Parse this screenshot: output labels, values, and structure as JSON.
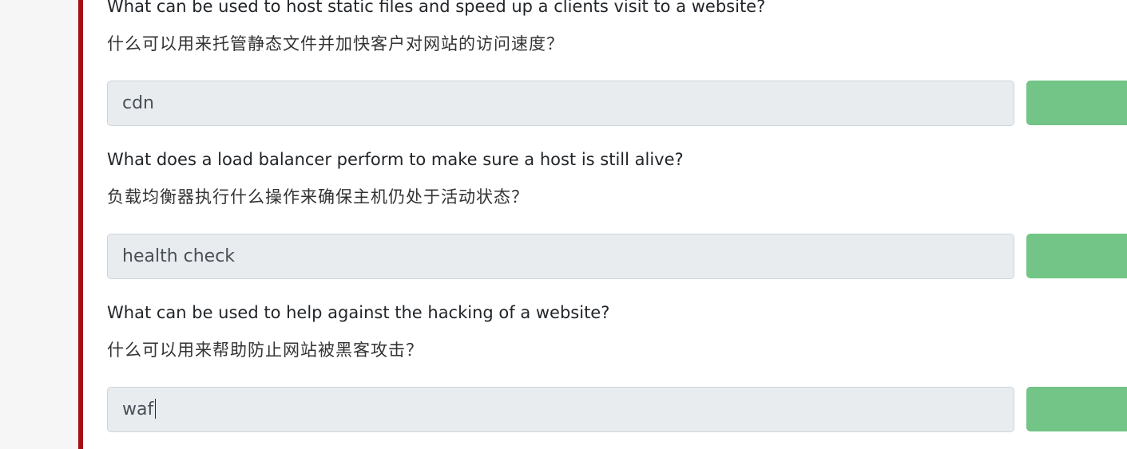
{
  "questions": [
    {
      "text_en": "What can be used to host static files and speed up a clients visit to a website?",
      "text_zh": "什么可以用来托管静态文件并加快客户对网站的访问速度？",
      "answer": "cdn",
      "submit_label": ""
    },
    {
      "text_en": "What does a load balancer perform to make sure a host is still alive?",
      "text_zh": "负载均衡器执行什么操作来确保主机仍处于活动状态？",
      "answer": "health check",
      "submit_label": ""
    },
    {
      "text_en": "What can be used to help against the hacking of a website?",
      "text_zh": "什么可以用来帮助防止网站被黑客攻击？",
      "answer": "waf",
      "submit_label": ""
    }
  ],
  "colors": {
    "accent_bar": "#a50f14",
    "input_bg": "#e9ecef",
    "submit_button": "#72c586",
    "gutter": "#f6f6f6"
  }
}
